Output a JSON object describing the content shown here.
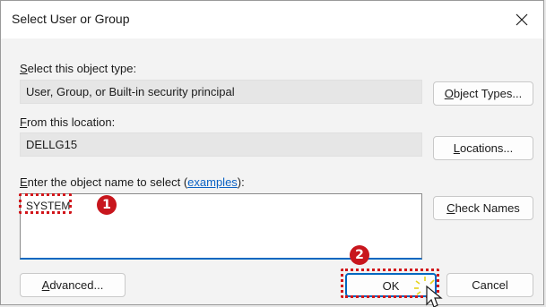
{
  "window": {
    "title": "Select User or Group"
  },
  "object_type": {
    "label_first": "S",
    "label_rest": "elect this object type:",
    "value": "User, Group, or Built-in security principal",
    "button_first": "O",
    "button_rest": "bject Types..."
  },
  "location": {
    "label_first": "F",
    "label_rest": "rom this location:",
    "value": "DELLG15",
    "button_first": "L",
    "button_rest": "ocations..."
  },
  "object_name": {
    "label_first": "E",
    "label_rest": "nter the object name to select (",
    "link_text": "examples",
    "label_end": "):",
    "typed_value": "SYSTEM",
    "check_names_first": "C",
    "check_names_rest": "heck Names"
  },
  "footer": {
    "advanced_first": "A",
    "advanced_rest": "dvanced...",
    "ok_label": "OK",
    "cancel_label": "Cancel"
  },
  "annotations": {
    "step1": "1",
    "step2": "2",
    "highlight_color": "#d1151a"
  }
}
